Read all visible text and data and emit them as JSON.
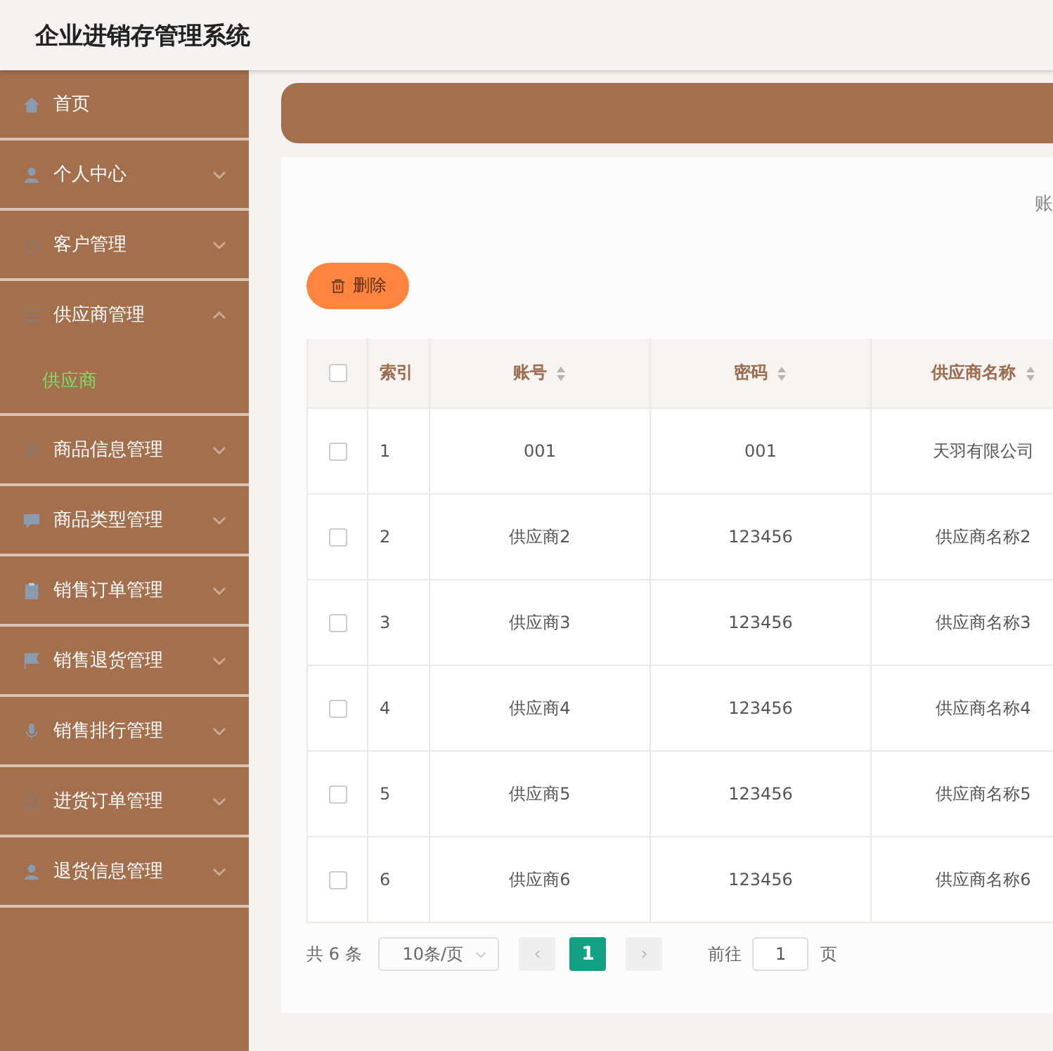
{
  "header": {
    "title": "企业进销存管理系统"
  },
  "sidebar": {
    "items": [
      {
        "label": "首页"
      },
      {
        "label": "个人中心",
        "expanded": false
      },
      {
        "label": "客户管理",
        "expanded": false
      },
      {
        "label": "供应商管理",
        "expanded": true,
        "children": [
          {
            "label": "供应商",
            "selected": true
          }
        ]
      },
      {
        "label": "商品信息管理",
        "expanded": false
      },
      {
        "label": "商品类型管理",
        "expanded": false
      },
      {
        "label": "销售订单管理",
        "expanded": false
      },
      {
        "label": "销售退货管理",
        "expanded": false
      },
      {
        "label": "销售排行管理",
        "expanded": false
      },
      {
        "label": "进货订单管理",
        "expanded": false
      },
      {
        "label": "退货信息管理",
        "expanded": false
      }
    ]
  },
  "search": {
    "label": "账"
  },
  "delete_button": {
    "label": "删除"
  },
  "table": {
    "header_checked": false,
    "columns": [
      {
        "label": "索引",
        "sortable": false
      },
      {
        "label": "账号",
        "sortable": true
      },
      {
        "label": "密码",
        "sortable": true
      },
      {
        "label": "供应商名称",
        "sortable": true
      }
    ],
    "rows": [
      {
        "checked": false,
        "cells": [
          "1",
          "001",
          "001",
          "天羽有限公司"
        ]
      },
      {
        "checked": false,
        "cells": [
          "2",
          "供应商2",
          "123456",
          "供应商名称2"
        ]
      },
      {
        "checked": false,
        "cells": [
          "3",
          "供应商3",
          "123456",
          "供应商名称3"
        ]
      },
      {
        "checked": false,
        "cells": [
          "4",
          "供应商4",
          "123456",
          "供应商名称4"
        ]
      },
      {
        "checked": false,
        "cells": [
          "5",
          "供应商5",
          "123456",
          "供应商名称5"
        ]
      },
      {
        "checked": false,
        "cells": [
          "6",
          "供应商6",
          "123456",
          "供应商名称6"
        ]
      }
    ]
  },
  "pagination": {
    "total": "共 6 条",
    "page_size": "10条/页",
    "prev": "‹",
    "pages": [
      {
        "label": "1",
        "selected": true
      }
    ],
    "next": "›",
    "goto_label": "前往",
    "goto_value": "1",
    "goto_suffix": "页"
  }
}
